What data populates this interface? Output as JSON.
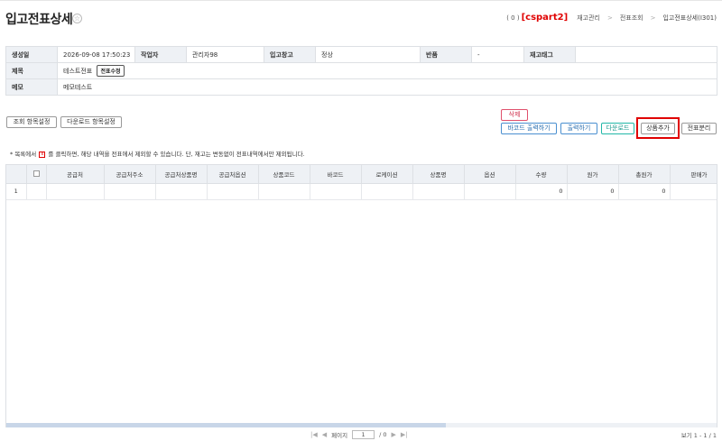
{
  "page": {
    "title": "입고전표상세",
    "count": "( 0 )",
    "account": "[cspart2]",
    "breadcrumb": [
      "재고관리",
      "전표조회",
      "입고전표상세(I301)"
    ],
    "breadcrumb_sep": ">"
  },
  "info": {
    "created_label": "생성일",
    "created_value": "2026-09-08 17:50:23",
    "worker_label": "작업자",
    "worker_value": "관리자98",
    "warehouse_label": "입고창고",
    "warehouse_value": "정상",
    "return_label": "반품",
    "return_value": "-",
    "tag_label": "재고태그",
    "tag_value": "",
    "title_label": "제목",
    "title_value": "테스트전표",
    "edit_title_button": "전표수정",
    "memo_label": "메모",
    "memo_value": "메모테스트"
  },
  "toolbar": {
    "view_columns": "조회 항목설정",
    "download_columns": "다운로드 항목설정",
    "delete": "삭제",
    "barcode_print": "바코드 출력하기",
    "print": "출력하기",
    "download": "다운로드",
    "add_product": "상품추가",
    "split_slip": "전표분리"
  },
  "notice": {
    "before": "* 목록에서",
    "x_icon": "x",
    "after": "를 클릭하면, 해당 내역을 전표에서 제외할 수 있습니다. 단, 재고는 변동없이 전표내역에서만 제외됩니다."
  },
  "grid": {
    "columns": [
      "",
      "",
      "공급처",
      "공급처주소",
      "공급처상품명",
      "공급처옵션",
      "상품코드",
      "바코드",
      "로케이션",
      "상품명",
      "옵션",
      "수량",
      "원가",
      "총원가",
      "판매가"
    ],
    "rows": [
      [
        "1",
        "",
        "",
        "",
        "",
        "",
        "",
        "",
        "",
        "",
        "",
        "0",
        "0",
        "0",
        ""
      ]
    ]
  },
  "pager": {
    "first": "|◀",
    "prev": "◀",
    "page_label": "페이지",
    "page_value": "1",
    "total": "/ 0",
    "next": "▶",
    "last": "▶|",
    "range": "보기 1 - 1 / 1"
  },
  "colors": {
    "accent_red": "#e00000",
    "header_bg": "#eef1f5",
    "blue_button": "#4a8fd0",
    "teal_button": "#22b8a8",
    "pink_button": "#e0506c"
  }
}
